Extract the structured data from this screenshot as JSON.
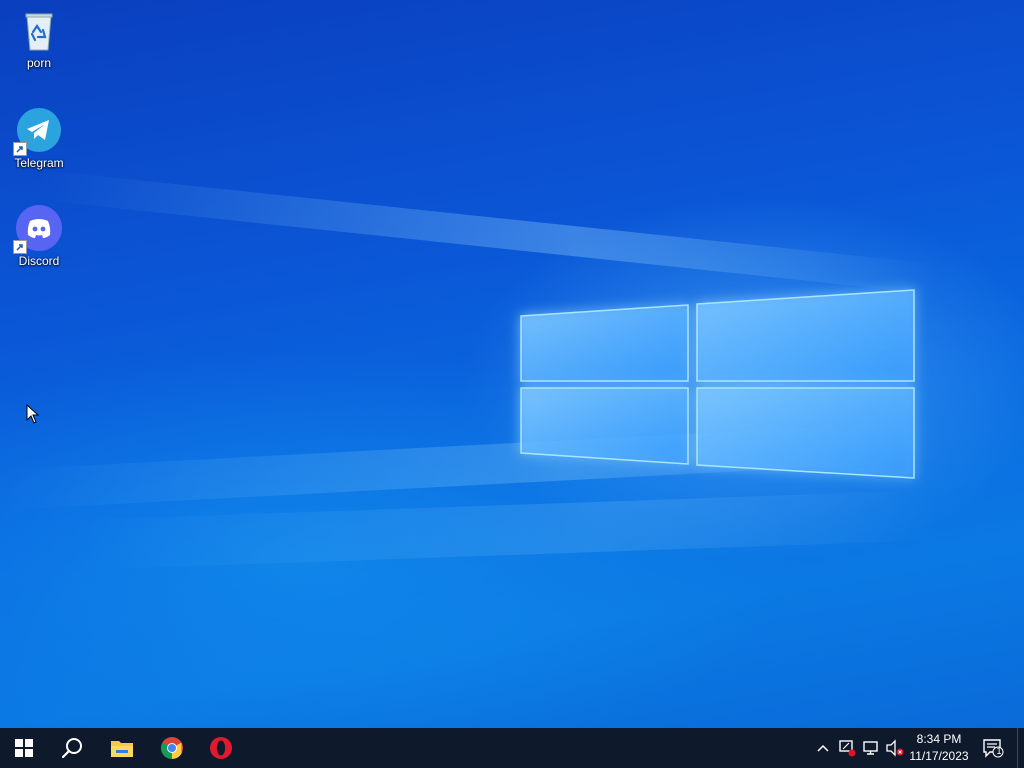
{
  "desktop": {
    "icons": [
      {
        "label": "porn",
        "icon": "recycle-bin-icon"
      },
      {
        "label": "Telegram",
        "icon": "telegram-icon"
      },
      {
        "label": "Discord",
        "icon": "discord-icon"
      }
    ],
    "wallpaper": "windows-10-hero-wallpaper"
  },
  "taskbar": {
    "start": {
      "icon": "windows-start-icon"
    },
    "search": {
      "icon": "search-icon"
    },
    "pinned": [
      {
        "name": "File Explorer",
        "icon": "folder-icon"
      },
      {
        "name": "Google Chrome",
        "icon": "chrome-icon"
      },
      {
        "name": "Opera",
        "icon": "opera-icon"
      }
    ],
    "tray": {
      "icons": [
        "chevron-up-icon",
        "network-warning-icon",
        "network-icon",
        "volume-muted-icon"
      ],
      "time": "8:34 PM",
      "date": "11/17/2023",
      "notification_count": "1"
    }
  },
  "colors": {
    "taskbar": "#0e1a2b",
    "wallpaper_primary": "#0b56d6",
    "accent": "#1e90ff"
  }
}
